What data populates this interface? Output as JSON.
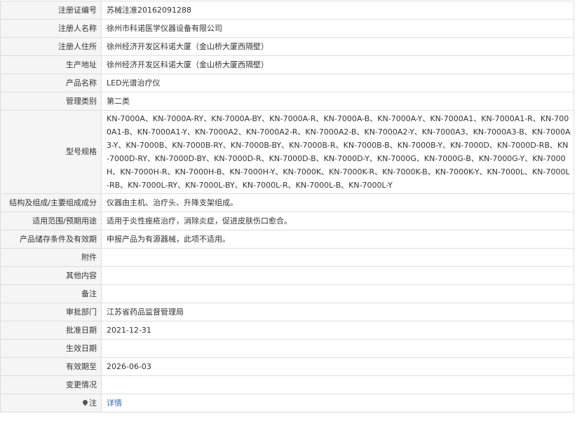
{
  "rows": {
    "reg_no": {
      "label": "注册证编号",
      "value": "苏械注准20162091288"
    },
    "registrant_name": {
      "label": "注册人名称",
      "value": "徐州市科诺医学仪器设备有限公司"
    },
    "registrant_address": {
      "label": "注册人住所",
      "value": "徐州经济开发区科诺大厦（金山桥大厦西隔壁）"
    },
    "production_address": {
      "label": "生产地址",
      "value": "徐州经济开发区科诺大厦（金山桥大厦西隔壁）"
    },
    "product_name": {
      "label": "产品名称",
      "value": "LED光谱治疗仪"
    },
    "management_class": {
      "label": "管理类别",
      "value": "第二类"
    },
    "model_spec": {
      "label": "型号规格",
      "value": "KN-7000A、KN-7000A-RY、KN-7000A-BY、KN-7000A-R、KN-7000A-B、KN-7000A-Y、KN-7000A1、KN-7000A1-R、KN-7000A1-B、KN-7000A1-Y、KN-7000A2、KN-7000A2-R、KN-7000A2-B、KN-7000A2-Y、KN-7000A3、KN-7000A3-B、KN-7000A3-Y、KN-7000B、KN-7000B-RY、KN-7000B-BY、KN-7000B-R、KN-7000B-B、KN-7000B-Y、KN-7000D、KN-7000D-RB、KN-7000D-RY、KN-7000D-BY、KN-7000D-R、KN-7000D-B、KN-7000D-Y、KN-7000G、KN-7000G-B、KN-7000G-Y、KN-7000H、KN-7000H-R、KN-7000H-B、KN-7000H-Y、KN-7000K、KN-7000K-R、KN-7000K-B、KN-7000K-Y、KN-7000L、KN-7000L-RB、KN-7000L-RY、KN-7000L-BY、KN-7000L-R、KN-7000L-B、KN-7000L-Y"
    },
    "structure": {
      "label": "结构及组成/主要组成成分",
      "value": "仪器由主机、治疗头、升降支架组成。"
    },
    "intended_use": {
      "label": "适用范围/预期用途",
      "value": "适用于炎性痤疮治疗，消除炎症，促进皮肤伤口愈合。"
    },
    "storage": {
      "label": "产品储存条件及有效期",
      "value": "申报产品为有源器械，此项不适用。"
    },
    "attachment": {
      "label": "附件",
      "value": ""
    },
    "other": {
      "label": "其他内容",
      "value": ""
    },
    "remarks": {
      "label": "备注",
      "value": ""
    },
    "approval_dept": {
      "label": "审批部门",
      "value": "江苏省药品监督管理局"
    },
    "approval_date": {
      "label": "批准日期",
      "value": "2021-12-31"
    },
    "effective_date": {
      "label": "生效日期",
      "value": ""
    },
    "valid_until": {
      "label": "有效期至",
      "value": "2026-06-03"
    },
    "changes": {
      "label": "变更情况",
      "value": ""
    },
    "note": {
      "label": "注",
      "icon": "pin-icon",
      "link_text": "详情"
    }
  }
}
